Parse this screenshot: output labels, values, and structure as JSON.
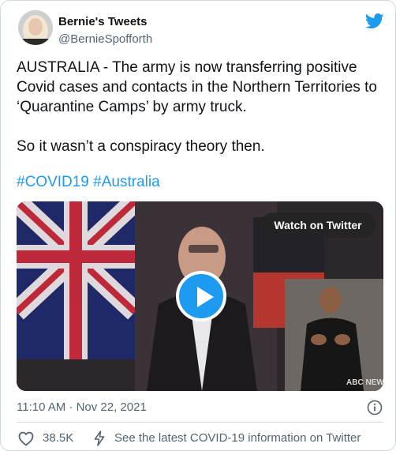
{
  "author": {
    "name": "Bernie's Tweets",
    "handle": "@BernieSpofforth",
    "avatar_icon": "avatar-photo",
    "brand_icon": "twitter-bird-icon",
    "brand_color": "#1d9bf0"
  },
  "tweet": {
    "text": "AUSTRALIA - The army is now transferring positive Covid cases and contacts in the Northern Territories to ‘Quarantine Camps’ by army truck.\n\nSo it wasn’t a conspiracy theory then.",
    "hashtags": [
      "#COVID19",
      "#Australia"
    ]
  },
  "media": {
    "watch_label": "Watch on Twitter",
    "watermark": "ABC NEWS",
    "play_icon": "play-icon"
  },
  "meta": {
    "timestamp": "11:10 AM · Nov 22, 2021",
    "info_icon": "info-icon"
  },
  "actions": {
    "likes": "38.5K",
    "like_icon": "heart-icon",
    "covid_icon": "lightning-icon",
    "covid_link": "See the latest COVID-19 information on Twitter"
  },
  "colors": {
    "text": "#0f1419",
    "secondary": "#536471",
    "link": "#1d9bf0",
    "border": "#cfd9de"
  }
}
